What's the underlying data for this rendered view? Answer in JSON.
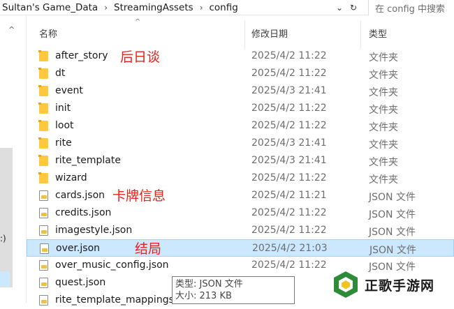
{
  "address_bar": {
    "breadcrumbs": [
      "Sultan's Game_Data",
      "StreamingAssets",
      "config"
    ],
    "separator": "›",
    "dropdown_glyph": "⌄",
    "refresh_glyph": "↻",
    "search_placeholder": "在 config 中搜索"
  },
  "nav_pane": {
    "scroll_up_glyph": "^",
    "partial_text": ":)"
  },
  "columns": {
    "name": "名称",
    "date": "修改日期",
    "type": "类型",
    "sort_glyph": "^"
  },
  "files": [
    {
      "name": "after_story",
      "date": "2025/4/2 11:22",
      "type": "文件夹",
      "kind": "folder"
    },
    {
      "name": "dt",
      "date": "2025/4/2 11:22",
      "type": "文件夹",
      "kind": "folder"
    },
    {
      "name": "event",
      "date": "2025/4/3 21:41",
      "type": "文件夹",
      "kind": "folder"
    },
    {
      "name": "init",
      "date": "2025/4/2 11:22",
      "type": "文件夹",
      "kind": "folder"
    },
    {
      "name": "loot",
      "date": "2025/4/2 11:22",
      "type": "文件夹",
      "kind": "folder"
    },
    {
      "name": "rite",
      "date": "2025/4/3 21:41",
      "type": "文件夹",
      "kind": "folder"
    },
    {
      "name": "rite_template",
      "date": "2025/4/3 21:41",
      "type": "文件夹",
      "kind": "folder"
    },
    {
      "name": "wizard",
      "date": "2025/4/2 11:22",
      "type": "文件夹",
      "kind": "folder"
    },
    {
      "name": "cards.json",
      "date": "2025/4/2 11:21",
      "type": "JSON 文件",
      "kind": "json"
    },
    {
      "name": "credits.json",
      "date": "2025/4/2 11:22",
      "type": "JSON 文件",
      "kind": "json"
    },
    {
      "name": "imagestyle.json",
      "date": "2025/4/2 11:22",
      "type": "JSON 文件",
      "kind": "json"
    },
    {
      "name": "over.json",
      "date": "2025/4/2 21:03",
      "type": "JSON 文件",
      "kind": "json",
      "selected": true
    },
    {
      "name": "over_music_config.json",
      "date": "2025/4/2 11:22",
      "type": "JSON 文件",
      "kind": "json"
    },
    {
      "name": "quest.json",
      "date": "11:2",
      "type": "",
      "kind": "json"
    },
    {
      "name": "rite_template_mappings",
      "date": "21:",
      "type": "",
      "kind": "json"
    }
  ],
  "annotations": {
    "after_story": "后日谈",
    "cards": "卡牌信息",
    "over": "结局"
  },
  "tooltip": {
    "line1": "类型: JSON 文件",
    "line2": "大小: 213 KB"
  },
  "watermark": {
    "text": "正歌手游网"
  },
  "colors": {
    "selection": "#cce8ff",
    "annotation_red": "#e8201a",
    "folder": "#ffc83d"
  }
}
